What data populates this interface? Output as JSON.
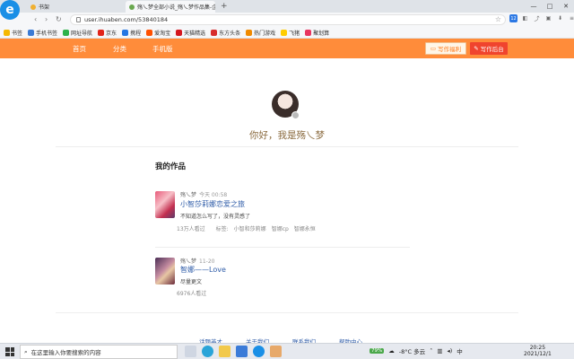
{
  "browser": {
    "tabs": [
      {
        "label": "书架",
        "active": false
      },
      {
        "label": "殇乀梦全部小说_殇乀梦作品集-企",
        "active": true
      }
    ],
    "new_tab": "+",
    "window_controls": [
      "—",
      "□",
      "✕"
    ],
    "url": "user.ihuaben.com/53840184",
    "bookmarks": [
      {
        "label": "书签",
        "color": "#f5b800"
      },
      {
        "label": "手机书签",
        "color": "#3a7bd5"
      },
      {
        "label": "网址导航",
        "color": "#2db24a"
      },
      {
        "label": "京东",
        "color": "#e1251b"
      },
      {
        "label": "携程",
        "color": "#2577e3"
      },
      {
        "label": "爱淘宝",
        "color": "#ff5000"
      },
      {
        "label": "天猫精选",
        "color": "#d4171f"
      },
      {
        "label": "东方头条",
        "color": "#d72c2c"
      },
      {
        "label": "热门游戏",
        "color": "#f08a00"
      },
      {
        "label": "飞猪",
        "color": "#ffcc00"
      },
      {
        "label": "聚划算",
        "color": "#e8355f"
      }
    ]
  },
  "site": {
    "nav": [
      "首页",
      "分类",
      "手机版"
    ],
    "welfare_button": "写作福利",
    "backend_button": "写作后台",
    "accent": "#ff8c3a"
  },
  "profile": {
    "greeting": "你好，我是殇乀梦"
  },
  "works": {
    "section_title": "我的作品",
    "items": [
      {
        "author": "殇乀梦",
        "time": "今天 00:58",
        "title": "小智莎莉娜恋爱之旅",
        "desc": "不知道怎么写了，没有灵感了",
        "views": "13万人看过",
        "tags_label": "标签:",
        "tags": [
          "小智和莎莉娜",
          "智娜cp",
          "智娜永恒"
        ]
      },
      {
        "author": "殇乀梦",
        "time": "11-20",
        "title": "智娜——Love",
        "desc": "尽量更文",
        "views": "6976人看过"
      }
    ]
  },
  "footer": {
    "links": [
      "话题英才",
      "关于我们",
      "联系我们",
      "帮助中心"
    ]
  },
  "taskbar": {
    "search_placeholder": "在这里输入你要搜索的内容",
    "tray_badge": "79%",
    "weather": "-8°C  多云",
    "time": "20:25",
    "date": "2021/12/1",
    "lang": "中"
  }
}
